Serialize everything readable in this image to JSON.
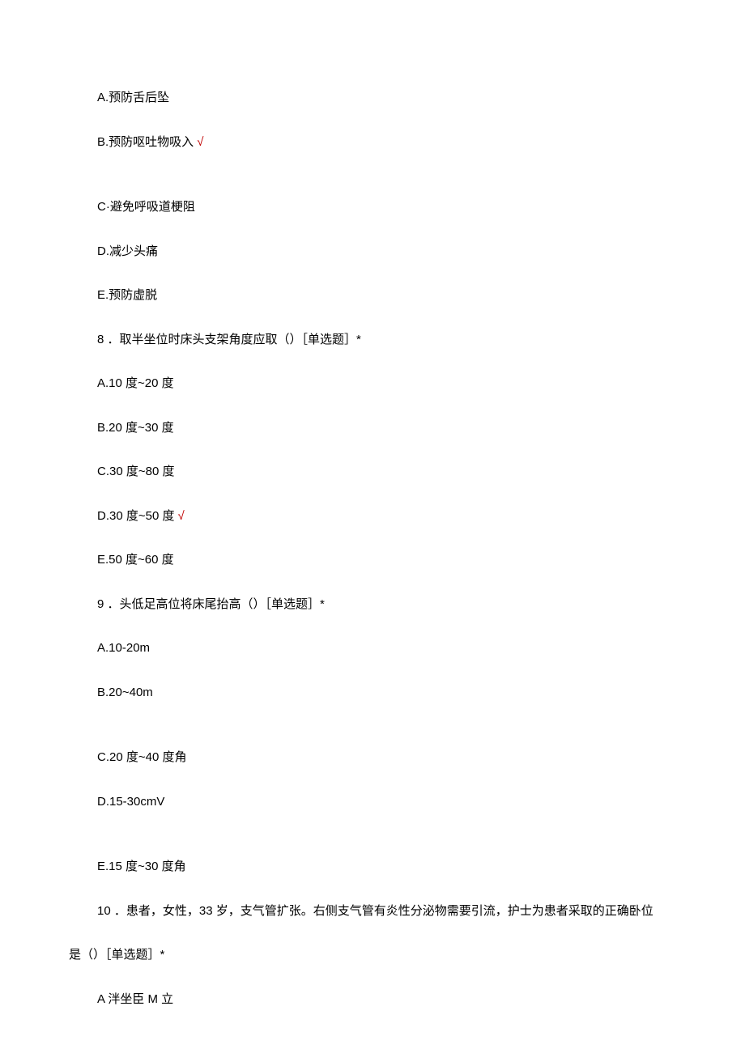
{
  "q7": {
    "optA": "A.预防舌后坠",
    "optB": "B.预防呕吐物吸入",
    "optB_check": "√",
    "optC": "C·避免呼吸道梗阻",
    "optD": "D.减少头痛",
    "optE": "E.预防虚脱"
  },
  "q8": {
    "stem": "8 ．取半坐位时床头支架角度应取（）［单选题］*",
    "optA": "A.10 度~20 度",
    "optB": "B.20 度~30 度",
    "optC": "C.30 度~80 度",
    "optD": "D.30 度~50 度",
    "optD_check": "√",
    "optE": "E.50 度~60 度"
  },
  "q9": {
    "stem": "9 ．头低足高位将床尾抬高（）［单选题］*",
    "optA": "A.10-20m",
    "optB": "B.20~40m",
    "optC": "C.20 度~40 度角",
    "optD": "D.15-30cmV",
    "optE": "E.15 度~30 度角"
  },
  "q10": {
    "stem_line1": "10 ．患者，女性，33 岁，支气管扩张。右侧支气管有炎性分泌物需要引流，护士为患者采取的正确卧位",
    "stem_line2": "是（）［单选题］*",
    "optA": "A 泮坐臣 M 立"
  }
}
